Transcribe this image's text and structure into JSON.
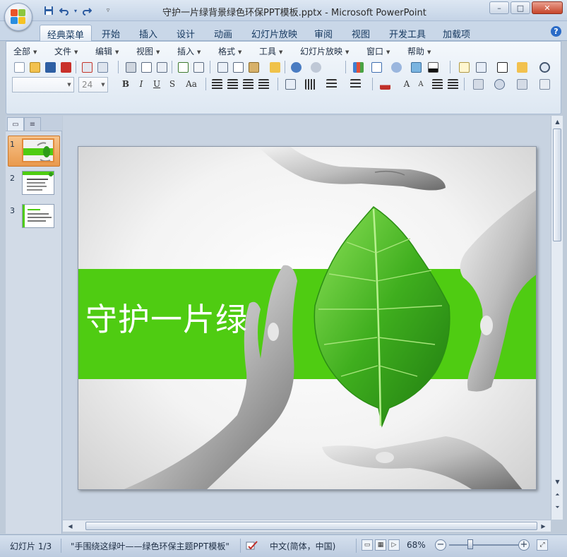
{
  "window": {
    "title": "守护一片绿背景绿色环保PPT模板.pptx - Microsoft PowerPoint",
    "minimize_label": "–",
    "maximize_label": "□",
    "close_label": "✕"
  },
  "ribbon_tabs": [
    {
      "label": "经典菜单",
      "active": true
    },
    {
      "label": "开始"
    },
    {
      "label": "插入"
    },
    {
      "label": "设计"
    },
    {
      "label": "动画"
    },
    {
      "label": "幻灯片放映"
    },
    {
      "label": "审阅"
    },
    {
      "label": "视图"
    },
    {
      "label": "开发工具"
    },
    {
      "label": "加载项"
    }
  ],
  "help_label": "?",
  "classic_menu": [
    "全部",
    "文件",
    "编辑",
    "视图",
    "插入",
    "格式",
    "工具",
    "幻灯片放映",
    "窗口",
    "帮助"
  ],
  "format_toolbar": {
    "font_name": "",
    "font_size": "24",
    "bold": "B",
    "italic": "I",
    "underline": "U",
    "shadow": "S",
    "change_case": "Aa"
  },
  "slides_pane": {
    "thumbnails": [
      {
        "number": "1",
        "selected": true
      },
      {
        "number": "2"
      },
      {
        "number": "3"
      }
    ]
  },
  "slide": {
    "title": "守护一片绿",
    "band_color": "#4fcc12"
  },
  "status": {
    "slide_counter": "幻灯片 1/3",
    "theme": "\"手围绕这绿叶——绿色环保主题PPT模板\"",
    "language": "中文(简体，中国)",
    "zoom": "68%",
    "zoom_minus": "−",
    "zoom_plus": "+"
  },
  "colors": {
    "accent_green": "#4fcc12",
    "ribbon_blue": "#c9d7e8",
    "selection_orange": "#e99a4d"
  }
}
